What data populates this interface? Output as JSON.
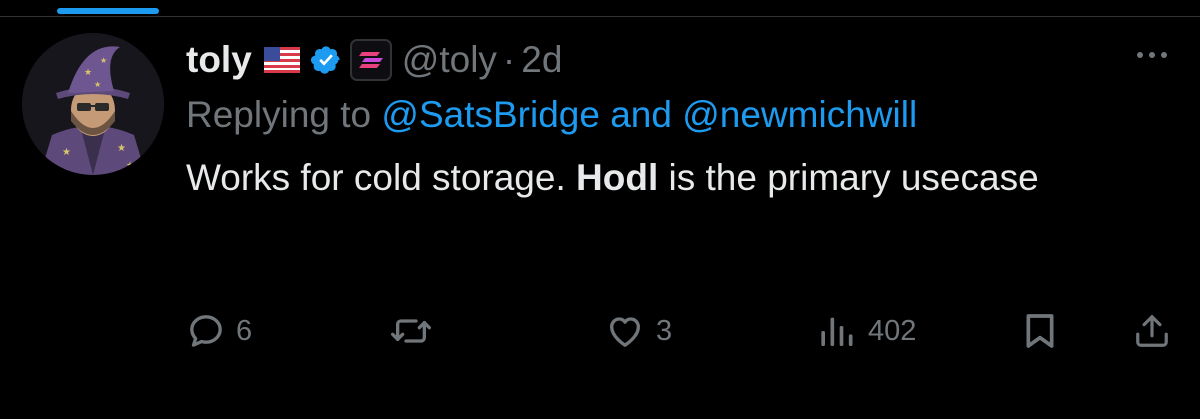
{
  "colors": {
    "background": "#000000",
    "text_primary": "#e7e9ea",
    "text_secondary": "#71767b",
    "accent": "#1d9bf0",
    "verified": "#1d9bf0"
  },
  "tweet": {
    "display_name": "toly",
    "handle": "@toly",
    "separator": "·",
    "time": "2d",
    "badges": [
      "us-flag-icon",
      "verified-badge-icon",
      "solana-affiliate-icon"
    ],
    "reply": {
      "prefix": "Replying to ",
      "mention_1": "@SatsBridge",
      "conjunction": " and ",
      "mention_2": "@newmichwill"
    },
    "text": {
      "part_1": "Works for cold storage. ",
      "bold": "Hodl",
      "part_2": " is the primary usecase"
    }
  },
  "actions": {
    "replies": {
      "icon": "reply-icon",
      "count": "6"
    },
    "retweets": {
      "icon": "retweet-icon",
      "count": ""
    },
    "likes": {
      "icon": "heart-icon",
      "count": "3"
    },
    "views": {
      "icon": "analytics-icon",
      "count": "402"
    },
    "bookmark": {
      "icon": "bookmark-icon"
    },
    "share": {
      "icon": "share-icon"
    }
  }
}
